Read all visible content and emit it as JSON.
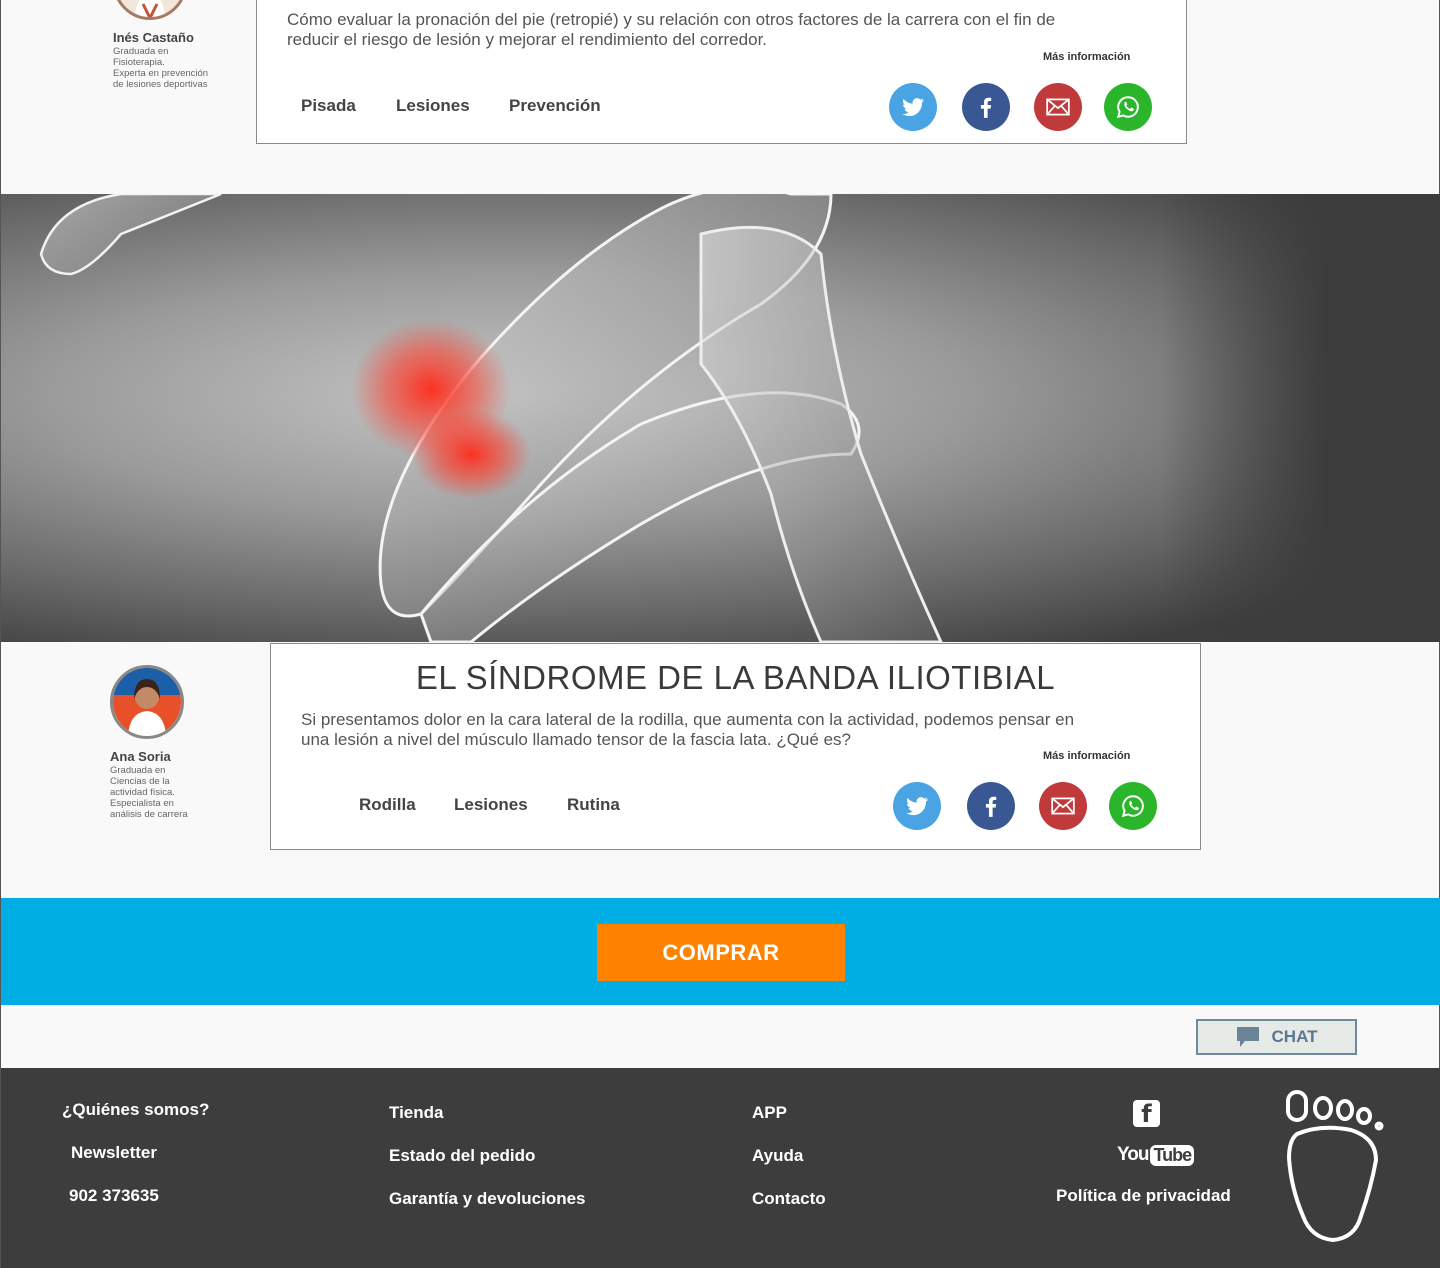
{
  "article1": {
    "author": {
      "name": "Inés Castaño",
      "bio": [
        "Graduada en",
        "Fisioterapia.",
        "Experta en prevención",
        "de lesiones deportivas"
      ]
    },
    "desc_lines": [
      "Cómo evaluar la pronación del pie (retropié) y su relación con otros factores de la carrera con el fin de",
      "reducir el riesgo de lesión y mejorar el rendimiento del corredor."
    ],
    "more_label": "Más información",
    "tags": [
      "Pisada",
      "Lesiones",
      "Prevención"
    ]
  },
  "article2": {
    "author": {
      "name": "Ana Soria",
      "bio": [
        "Graduada en",
        "Ciencias de la",
        "actividad física.",
        "Especialista en",
        "análisis de carrera"
      ]
    },
    "title": "EL SÍNDROME DE LA BANDA ILIOTIBIAL",
    "desc_lines": [
      "Si presentamos dolor en la cara lateral de la rodilla, que aumenta con la actividad, podemos pensar en",
      "una lesión a nivel del músculo llamado tensor de la fascia lata. ¿Qué es?"
    ],
    "more_label": "Más información",
    "tags": [
      "Rodilla",
      "Lesiones",
      "Rutina"
    ]
  },
  "share_icons": [
    "twitter-icon",
    "facebook-icon",
    "mail-icon",
    "whatsapp-icon"
  ],
  "buy_label": "COMPRAR",
  "chat_label": "CHAT",
  "footer": {
    "col1": [
      "¿Quiénes somos?",
      "Newsletter",
      "902 373635"
    ],
    "col2": [
      "Tienda",
      "Estado del pedido",
      "Garantía y devoluciones"
    ],
    "col3": [
      "APP",
      "Ayuda",
      "Contacto"
    ],
    "social": {
      "facebook": "f",
      "youtube_you": "You",
      "youtube_tube": "Tube"
    },
    "privacy": "Política de privacidad"
  },
  "colors": {
    "blue_band": "#00aee3",
    "buy_button": "#ff8300",
    "footer_bg": "#3d3d3d",
    "twitter": "#4aa3e3",
    "facebook": "#395793",
    "mail": "#c0393b",
    "whatsapp": "#2bb52b"
  }
}
